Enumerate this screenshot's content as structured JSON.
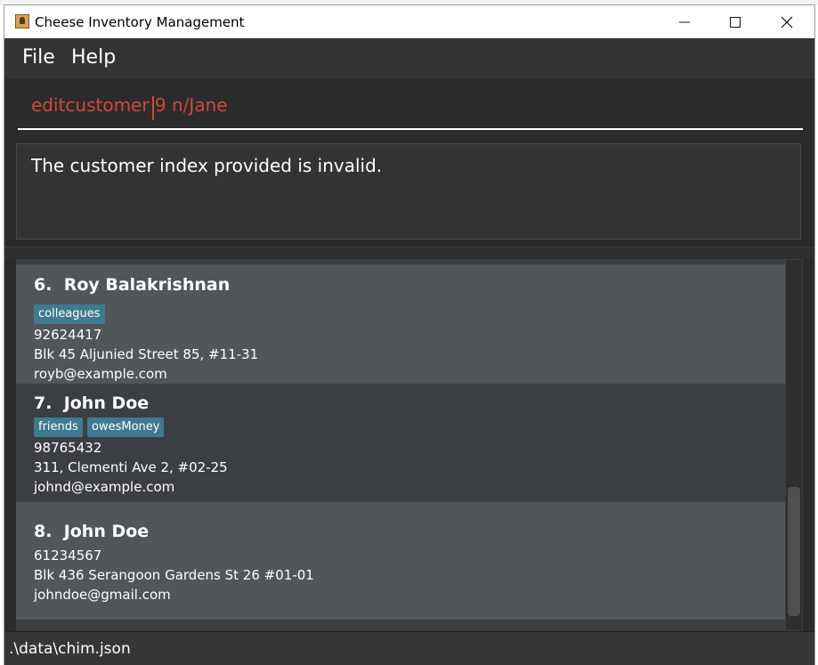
{
  "window": {
    "title": "Cheese Inventory Management",
    "controls": {
      "minimize": "minimize-icon",
      "maximize": "maximize-icon",
      "close": "close-icon"
    }
  },
  "menu": {
    "file": "File",
    "help": "Help"
  },
  "command": {
    "value": "editcustomer 9 n/Jane"
  },
  "result": {
    "message": "The customer index provided is invalid."
  },
  "customers": [
    {
      "index": "6.",
      "name": "Roy Balakrishnan",
      "tags": [
        "colleagues"
      ],
      "phone": "92624417",
      "address": "Blk 45 Aljunied Street 85, #11-31",
      "email": "royb@example.com"
    },
    {
      "index": "7.",
      "name": "John Doe",
      "tags": [
        "friends",
        "owesMoney"
      ],
      "phone": "98765432",
      "address": "311, Clementi Ave 2, #02-25",
      "email": "johnd@example.com"
    },
    {
      "index": "8.",
      "name": "John Doe",
      "tags": [],
      "phone": "61234567",
      "address": "Blk 436 Serangoon Gardens St 26 #01-01",
      "email": "johndoe@gmail.com"
    }
  ],
  "status": {
    "file_path": ".\\data\\chim.json"
  },
  "colors": {
    "accent_error": "#d1483a",
    "tag_bg": "#3e7b91",
    "card_light": "#515658",
    "card_dark": "#3c3f41"
  }
}
